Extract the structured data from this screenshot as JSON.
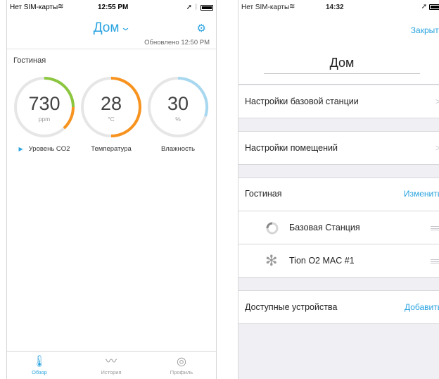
{
  "left": {
    "status": {
      "carrier": "Нет SIM-карты",
      "time": "12:55 PM"
    },
    "nav": {
      "title": "Дом",
      "updated": "Обновлено 12:50 PM"
    },
    "room": "Гостиная",
    "gauges": [
      {
        "value": "730",
        "unit": "ppm",
        "label": "Уровень CO2",
        "level": 0.45,
        "color": "#8cc63f",
        "color2": "#f7931e"
      },
      {
        "value": "28",
        "unit": "°C",
        "label": "Температура",
        "level": 0.5,
        "color": "#f7931e",
        "color2": "#f7931e"
      },
      {
        "value": "30",
        "unit": "%",
        "label": "Влажность",
        "level": 0.3,
        "color": "#a8d8f0",
        "color2": "#a8d8f0"
      }
    ],
    "tabs": [
      {
        "label": "Обзор",
        "icon": "thermometer-icon"
      },
      {
        "label": "История",
        "icon": "chart-icon"
      },
      {
        "label": "Профиль",
        "icon": "profile-icon"
      }
    ]
  },
  "right": {
    "status": {
      "carrier": "Нет SIM-карты",
      "time": "14:32"
    },
    "close": "Закрыть",
    "house": "Дом",
    "base_settings": "Настройки базовой станции",
    "room_settings": "Настройки помещений",
    "room": {
      "name": "Гостиная",
      "action": "Изменить"
    },
    "devices": [
      {
        "name": "Базовая Станция",
        "icon": "ring-icon"
      },
      {
        "name": "Tion O2 MAC #1",
        "icon": "fan-icon"
      }
    ],
    "available": {
      "label": "Доступные устройства",
      "action": "Добавить"
    }
  },
  "colors": {
    "accent": "#2aa3e0"
  }
}
